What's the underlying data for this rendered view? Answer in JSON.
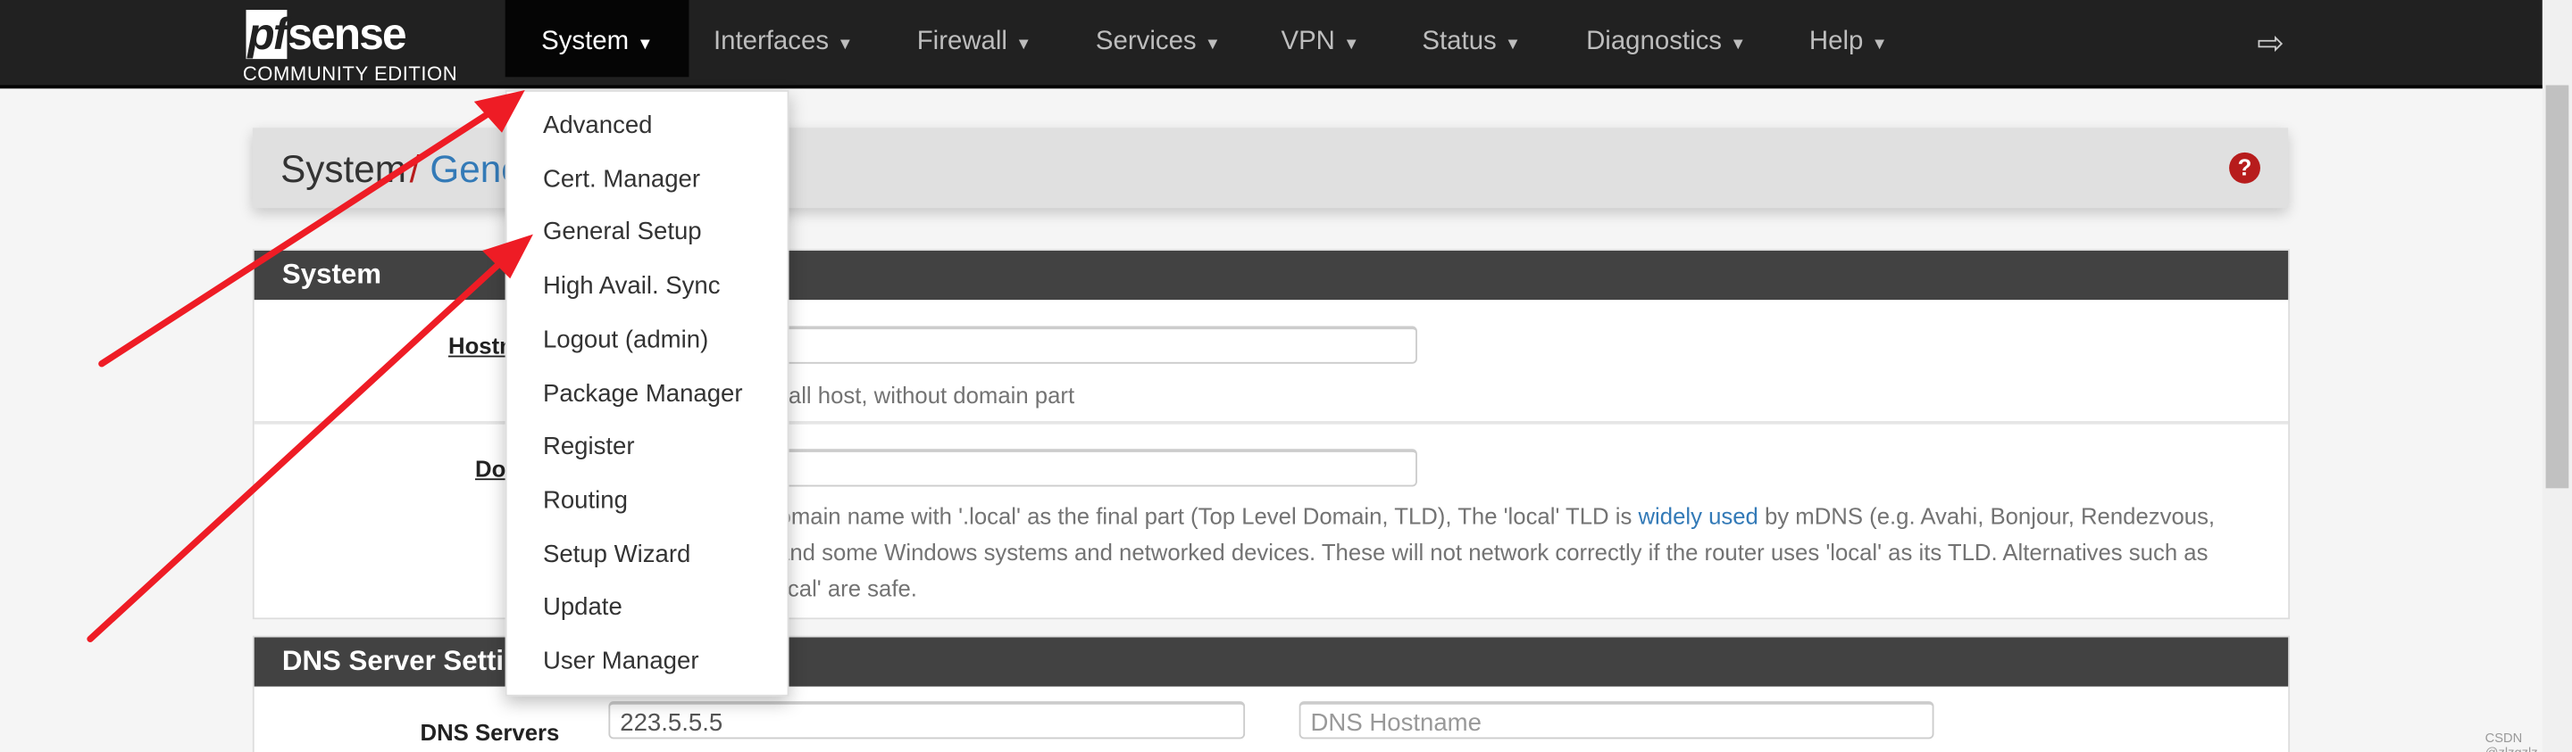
{
  "brand": {
    "logo": "pfsense",
    "edition": "COMMUNITY EDITION"
  },
  "nav": {
    "items": [
      {
        "label": "System",
        "active": true
      },
      {
        "label": "Interfaces"
      },
      {
        "label": "Firewall"
      },
      {
        "label": "Services"
      },
      {
        "label": "VPN"
      },
      {
        "label": "Status"
      },
      {
        "label": "Diagnostics"
      },
      {
        "label": "Help"
      }
    ],
    "logout_icon": "sign-out-icon"
  },
  "breadcrumb": {
    "parent": "System",
    "separator": "/",
    "current": "General Setup",
    "help_icon": "question-circle-icon"
  },
  "system_panel": {
    "title": "System",
    "hostname": {
      "label": "Hostname",
      "value": "",
      "hint": "Name of the firewall host, without domain part"
    },
    "domain": {
      "label": "Domain",
      "value": "",
      "hint_before": "Do not end the domain name with '.local' as the final part (Top Level Domain, TLD), The 'local' TLD is ",
      "hint_link": "widely used",
      "hint_after": " by mDNS (e.g. Avahi, Bonjour, Rendezvous, Airprint, Airplay) and some Windows systems and networked devices. These will not network correctly if the router uses 'local' as its TLD. Alternatives such as 'local.lan' or 'mylocal' are safe."
    }
  },
  "dns_panel": {
    "title": "DNS Server Settings",
    "dns_servers": {
      "label": "DNS Servers",
      "value": "223.5.5.5",
      "hostname_placeholder": "DNS Hostname"
    }
  },
  "system_menu": {
    "items": [
      "Advanced",
      "Cert. Manager",
      "General Setup",
      "High Avail. Sync",
      "Logout (admin)",
      "Package Manager",
      "Register",
      "Routing",
      "Setup Wizard",
      "Update",
      "User Manager"
    ]
  },
  "annotation_color": "#ee1c25",
  "colors": {
    "navbar": "#212121",
    "panel_heading": "#424242",
    "link": "#337ab7",
    "help": "#b71c1c"
  },
  "watermark": "CSDN @zlzgzlz"
}
